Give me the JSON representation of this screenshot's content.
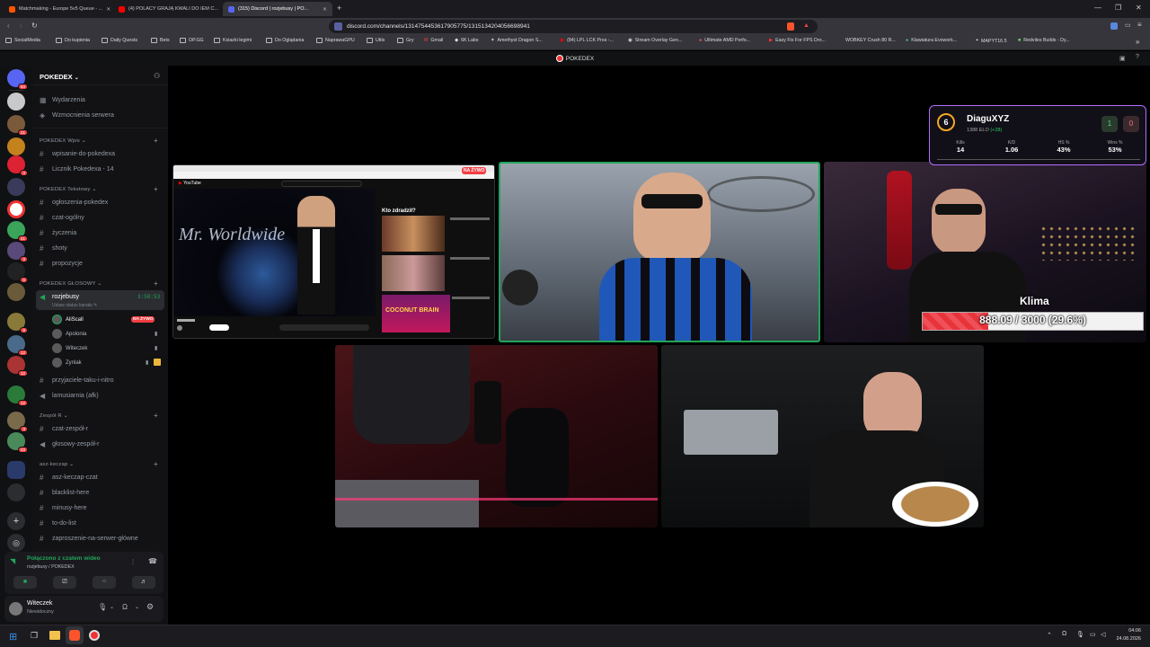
{
  "browser": {
    "tabs": [
      {
        "label": "Matchmaking - Europe 5v5 Queue - ..."
      },
      {
        "label": "(4) POLACY GRAJĄ KWALI DO IEM C..."
      },
      {
        "label": "(315) Discord | rozjebusy | PO..."
      }
    ],
    "url": "discord.com/channels/1314754453617905775/1315134204056698941",
    "bookmarks": [
      "SocialMedia",
      "Do kupienia",
      "Daily Quests",
      "Bets",
      "OP.GG",
      "Ksiazki legimi",
      "Do Oglądania",
      "NaprawaGPU",
      "Utils",
      "Gry",
      "Gmail",
      "6K Labs",
      "Amethyst Dragon S...",
      "(84) LPL LCK Pros -...",
      "Stream Overlay Gen...",
      "Ultimate AMD Perfo...",
      "Easy Fix For FPS Dro...",
      "WOBKEY Crush 80 R...",
      "Klawiatura Evowork...",
      "MAPYT16.5",
      "Redviles Builds - Dy..."
    ]
  },
  "discord": {
    "window_title": "POKEDEX",
    "server_name": "POKEDEX",
    "top_items": [
      "Wydarzenia",
      "Wzmocnienia serwera"
    ],
    "categories": {
      "wpis": "POKEDEX Wpis",
      "tekstowy": "POKEDEX Tekstowy",
      "glosowy": "POKEDEX GŁOSOWY",
      "zespolr": "Zespół R",
      "asz": "asz-keczap"
    },
    "channels_wpis": [
      "wpisanie-do-pokedexa",
      "Licznik Pokedexa - 14"
    ],
    "channels_tekst": [
      "ogłoszenia-pokedex",
      "czat-ogólny",
      "życzenia",
      "shoty",
      "propozycje"
    ],
    "voice_channel": {
      "name": "rozjebusy",
      "timer": "3:58:53",
      "status": "Ustaw status kanału"
    },
    "voice_users": [
      {
        "name": "AliScall",
        "live": "NA ŻYWO"
      },
      {
        "name": "Apolonia"
      },
      {
        "name": "Witeczek"
      },
      {
        "name": "Zynlak"
      }
    ],
    "channels_after": [
      "przyjaciele-taku-i-nitro",
      "lamusiarnia (afk)"
    ],
    "channels_zespol": [
      "czat-zespół-r",
      "głosowy-zespół-r"
    ],
    "channels_asz": [
      "asz-keczap-czat",
      "blacklist-here",
      "minusy-here",
      "to-do-list",
      "zaproszenie-na-serwer-główne"
    ],
    "voice_connected": {
      "title": "Połączono z czatem wideo",
      "sub": "rozjebusy / POKEDEX"
    },
    "user": {
      "name": "Witeczek",
      "status": "Niewidoczny"
    },
    "server_badges": [
      "64",
      "21",
      "4",
      "41",
      "3",
      "6",
      "8",
      "12",
      "12",
      "12",
      "3",
      "23"
    ]
  },
  "stream": {
    "live_label": "NA ŻYWO",
    "video_title": "Mr. Worldwide",
    "side_text": "Kto zdradził?",
    "thumb_text": "COCONUT BRAIN",
    "faceit": {
      "level": "6",
      "name": "DiaguXYZ",
      "elo": "1388 ELO",
      "elo_change": "(+28)",
      "score_left": "1",
      "score_right": "0",
      "stats": [
        {
          "label": "Kills",
          "value": "14"
        },
        {
          "label": "K/D",
          "value": "1.06"
        },
        {
          "label": "HS %",
          "value": "43%"
        },
        {
          "label": "Wins %",
          "value": "53%"
        }
      ]
    },
    "goal": {
      "name": "Klima",
      "text": "888.09 / 3000 (29.6%)",
      "fraction": 0.296
    }
  },
  "taskbar": {
    "time": "04:06",
    "date": "24.08.2026"
  },
  "colors": {
    "green": "#23a55a",
    "red": "#f23f43",
    "faceit_border": "#b46cff"
  }
}
